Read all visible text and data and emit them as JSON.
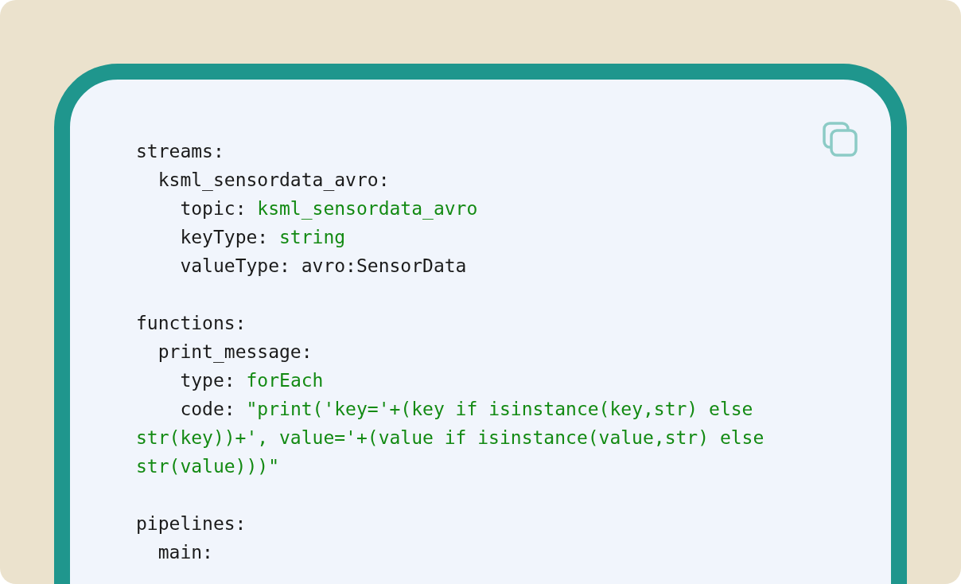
{
  "code": [
    {
      "key": "streams:",
      "children": [
        {
          "key": "ksml_sensordata_avro:",
          "children": [
            {
              "key": "topic:",
              "value": "ksml_sensordata_avro",
              "kind": "string"
            },
            {
              "key": "keyType:",
              "value": "string",
              "kind": "string"
            },
            {
              "key": "valueType:",
              "value": "avro:SensorData",
              "kind": "plain"
            }
          ]
        }
      ]
    },
    {
      "key": "functions:",
      "children": [
        {
          "key": "print_message:",
          "children": [
            {
              "key": "type:",
              "value": "forEach",
              "kind": "string"
            },
            {
              "key": "code:",
              "value": "\"print('key='+(key if isinstance(key,str) else str(key))+', value='+(value if isinstance(value,str) else str(value)))\"",
              "kind": "string"
            }
          ]
        }
      ]
    },
    {
      "key": "pipelines:",
      "children": [
        {
          "key": "main:"
        }
      ]
    }
  ]
}
